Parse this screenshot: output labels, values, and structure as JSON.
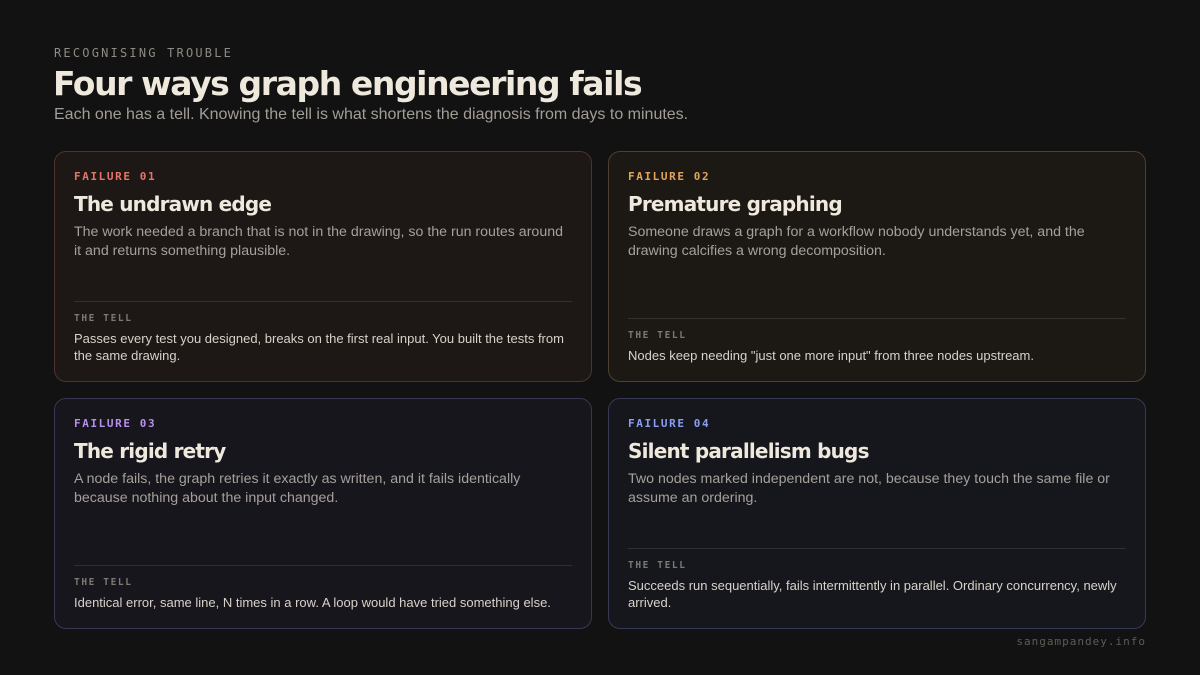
{
  "header": {
    "eyebrow": "RECOGNISING TROUBLE",
    "title": "Four ways graph engineering fails",
    "subtitle": "Each one has a tell. Knowing the tell is what shortens the diagnosis from days to minutes."
  },
  "accents": {
    "failure_01": "#e4756b",
    "failure_02": "#e2a35a",
    "failure_03": "#b590ec",
    "failure_04": "#8c9cf2"
  },
  "cards": [
    {
      "tag": "FAILURE 01",
      "title": "The undrawn edge",
      "body": "The work needed a branch that is not in the drawing, so the run routes around it and returns something plausible.",
      "tell_label": "THE TELL",
      "tell": "Passes every test you designed, breaks on the first real input. You built the tests from the same drawing."
    },
    {
      "tag": "FAILURE 02",
      "title": "Premature graphing",
      "body": "Someone draws a graph for a workflow nobody understands yet, and the drawing calcifies a wrong decomposition.",
      "tell_label": "THE TELL",
      "tell": "Nodes keep needing \"just one more input\" from three nodes upstream."
    },
    {
      "tag": "FAILURE 03",
      "title": "The rigid retry",
      "body": "A node fails, the graph retries it exactly as written, and it fails identically because nothing about the input changed.",
      "tell_label": "THE TELL",
      "tell": "Identical error, same line, N times in a row. A loop would have tried something else."
    },
    {
      "tag": "FAILURE 04",
      "title": "Silent parallelism bugs",
      "body": "Two nodes marked independent are not, because they touch the same file or assume an ordering.",
      "tell_label": "THE TELL",
      "tell": "Succeeds run sequentially, fails intermittently in parallel. Ordinary concurrency, newly arrived."
    }
  ],
  "footer": {
    "site": "sangampandey.info"
  }
}
